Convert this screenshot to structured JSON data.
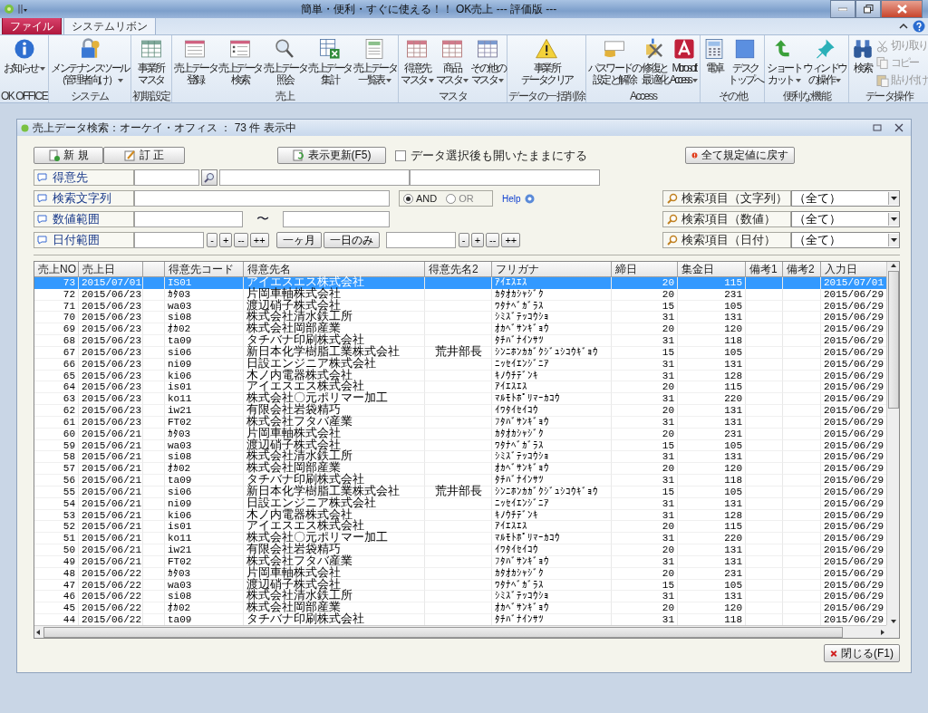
{
  "title_bar": {
    "title": "簡単・便利・すぐに使える！！ OK売上 --- 評価版 ---"
  },
  "ribbon": {
    "tabs": [
      {
        "label": "ファイル",
        "kind": "file",
        "selected": false
      },
      {
        "label": "システムリボン",
        "kind": "tab",
        "selected": true
      }
    ],
    "groups": [
      {
        "label": "OK OFFICE",
        "buttons": [
          {
            "lines": [
              "お知らせ"
            ],
            "dropdown": true
          }
        ]
      },
      {
        "label": "システム",
        "buttons": [
          {
            "lines": [
              "メンテナンスツール",
              "（管理者向け）"
            ],
            "dropdown": true
          }
        ]
      },
      {
        "label": "初期設定",
        "buttons": [
          {
            "lines": [
              "事業所",
              "マスタ"
            ],
            "dropdown": false
          }
        ]
      },
      {
        "label": "売上",
        "buttons": [
          {
            "lines": [
              "売上データ",
              "登録"
            ],
            "dropdown": false
          },
          {
            "lines": [
              "売上データ",
              "検索"
            ],
            "dropdown": false
          },
          {
            "lines": [
              "売上データ",
              "照会"
            ],
            "dropdown": false
          },
          {
            "lines": [
              "売上データ",
              "集計"
            ],
            "dropdown": false
          },
          {
            "lines": [
              "売上データ",
              "一覧表"
            ],
            "dropdown": true
          }
        ]
      },
      {
        "label": "マスタ",
        "buttons": [
          {
            "lines": [
              "得意先",
              "マスタ"
            ],
            "dropdown": true
          },
          {
            "lines": [
              "商品",
              "マスタ"
            ],
            "dropdown": true
          },
          {
            "lines": [
              "その他の",
              "マスタ"
            ],
            "dropdown": true
          }
        ]
      },
      {
        "label": "データの一括削除",
        "buttons": [
          {
            "lines": [
              "事業所",
              "データクリア"
            ],
            "dropdown": false
          }
        ]
      },
      {
        "label": "Access",
        "buttons": [
          {
            "lines": [
              "パスワードの",
              "設定と解除"
            ],
            "dropdown": false
          },
          {
            "lines": [
              "修復と",
              "最適化"
            ],
            "dropdown": false
          },
          {
            "lines": [
              "Microsoft",
              "Access"
            ],
            "dropdown": true
          }
        ]
      },
      {
        "label": "その他",
        "buttons": [
          {
            "lines": [
              "電卓"
            ],
            "dropdown": false
          },
          {
            "lines": [
              "デスク",
              "トップへ"
            ],
            "dropdown": false
          }
        ]
      },
      {
        "label": "便利な機能",
        "buttons": [
          {
            "lines": [
              "ショート",
              "カット"
            ],
            "dropdown": true
          },
          {
            "lines": [
              "ウィンドウ",
              "の操作"
            ],
            "dropdown": true
          }
        ]
      },
      {
        "label": "データ操作",
        "buttons": [
          {
            "lines": [
              "検索"
            ],
            "dropdown": false
          }
        ],
        "small_buttons": [
          {
            "label": "切り取り",
            "disabled": true
          },
          {
            "label": "コピー",
            "disabled": true
          },
          {
            "label": "貼り付け",
            "disabled": true
          }
        ]
      }
    ]
  },
  "search_window": {
    "title": "売上データ検索：オーケイ・オフィス ： 73 件 表示中",
    "toolbar": {
      "new": "新 規",
      "edit": "訂 正",
      "refresh": "表示更新(F5)",
      "keep_open": {
        "label": "データ選択後も開いたままにする",
        "checked": false
      },
      "reset": "全て規定値に戻す"
    },
    "filters": {
      "customer": "得意先",
      "text": "検索文字列",
      "number": "数値範囲",
      "date": "日付範囲",
      "modes": [
        {
          "label": "AND",
          "selected": true
        },
        {
          "label": "OR",
          "selected": false
        }
      ],
      "help": "Help",
      "range_separator": "〜",
      "date_steps": [
        "-",
        "+",
        "--",
        "++"
      ],
      "date_presets": [
        "一ヶ月",
        "一日のみ"
      ],
      "date_steps_2": [
        "-",
        "+",
        "--",
        "++"
      ],
      "search_items": [
        {
          "label": "検索項目（文字列）",
          "value": "（全て）"
        },
        {
          "label": "検索項目（数値）",
          "value": "（全て）"
        },
        {
          "label": "検索項目（日付）",
          "value": "（全て）"
        }
      ]
    },
    "table": {
      "columns": [
        "売上NO",
        "売上日",
        "得意先コード",
        "得意先名",
        "得意先名2",
        "フリガナ",
        "締日",
        "集金日",
        "備考1",
        "備考2",
        "入力日"
      ],
      "rows": [
        {
          "no": "73",
          "date": "2015/07/01",
          "code": "IS01",
          "name": "アイエスエス株式会社",
          "kana": "ｱｲｴｽｴｽ",
          "closing": "20",
          "collection": "115",
          "entry": "2015/07/01",
          "selected": true
        },
        {
          "no": "72",
          "date": "2015/06/23",
          "code": "ｶﾀ03",
          "name": "片岡車軸株式会社",
          "kana": "ｶﾀｵｶｼｬｼﾞｸ",
          "closing": "20",
          "collection": "231",
          "entry": "2015/06/29",
          "selected": false
        },
        {
          "no": "71",
          "date": "2015/06/23",
          "code": "wa03",
          "name": "渡辺硝子株式会社",
          "kana": "ﾜﾀﾅﾍﾞｶﾞﾗｽ",
          "closing": "15",
          "collection": "105",
          "entry": "2015/06/29",
          "selected": false
        },
        {
          "no": "70",
          "date": "2015/06/23",
          "code": "si08",
          "name": "株式会社清水鉄工所",
          "kana": "ｼﾐｽﾞﾃｯｺｳｼｮ",
          "closing": "31",
          "collection": "131",
          "entry": "2015/06/29",
          "selected": false
        },
        {
          "no": "69",
          "date": "2015/06/23",
          "code": "ｵｶ02",
          "name": "株式会社岡部産業",
          "kana": "ｵｶﾍﾞｻﾝｷﾞｮｳ",
          "closing": "20",
          "collection": "120",
          "entry": "2015/06/29",
          "selected": false
        },
        {
          "no": "68",
          "date": "2015/06/23",
          "code": "ta09",
          "name": "タチバナ印刷株式会社",
          "kana": "ﾀﾁﾊﾞﾅｲﾝｻﾂ",
          "closing": "31",
          "collection": "118",
          "entry": "2015/06/29",
          "selected": false
        },
        {
          "no": "67",
          "date": "2015/06/23",
          "code": "si06",
          "name": "新日本化学樹脂工業株式会社",
          "name2": "荒井部長",
          "kana": "ｼﾝﾆﾎﾝｶｶﾞｸｼﾞｭｼｺｳｷﾞｮｳ",
          "closing": "15",
          "collection": "105",
          "entry": "2015/06/29",
          "selected": false
        },
        {
          "no": "66",
          "date": "2015/06/23",
          "code": "ni09",
          "name": "日設エンジニア株式会社",
          "kana": "ﾆｯｾｲｴﾝｼﾞﾆｱ",
          "closing": "31",
          "collection": "131",
          "entry": "2015/06/29",
          "selected": false
        },
        {
          "no": "65",
          "date": "2015/06/23",
          "code": "ki06",
          "name": "木ノ内電器株式会社",
          "kana": "ｷﾉｳﾁﾃﾞﾝｷ",
          "closing": "31",
          "collection": "128",
          "entry": "2015/06/29",
          "selected": false
        },
        {
          "no": "64",
          "date": "2015/06/23",
          "code": "is01",
          "name": "アイエスエス株式会社",
          "kana": "ｱｲｴｽｴｽ",
          "closing": "20",
          "collection": "115",
          "entry": "2015/06/29",
          "selected": false
        },
        {
          "no": "63",
          "date": "2015/06/23",
          "code": "ko11",
          "name": "株式会社〇元ポリマー加工",
          "kana": "ﾏﾙﾓﾄﾎﾟﾘﾏｰｶｺｳ",
          "closing": "31",
          "collection": "220",
          "entry": "2015/06/29",
          "selected": false
        },
        {
          "no": "62",
          "date": "2015/06/23",
          "code": "iw21",
          "name": "有限会社岩袋精巧",
          "kana": "ｲﾜﾀｲｾｲｺｳ",
          "closing": "20",
          "collection": "131",
          "entry": "2015/06/29",
          "selected": false
        },
        {
          "no": "61",
          "date": "2015/06/23",
          "code": "FT02",
          "name": "株式会社フタバ産業",
          "kana": "ﾌﾀﾊﾞｻﾝｷﾞｮｳ",
          "closing": "31",
          "collection": "131",
          "entry": "2015/06/29",
          "selected": false
        },
        {
          "no": "60",
          "date": "2015/06/21",
          "code": "ｶﾀ03",
          "name": "片岡車軸株式会社",
          "kana": "ｶﾀｵｶｼｬｼﾞｸ",
          "closing": "20",
          "collection": "231",
          "entry": "2015/06/29",
          "selected": false
        },
        {
          "no": "59",
          "date": "2015/06/21",
          "code": "wa03",
          "name": "渡辺硝子株式会社",
          "kana": "ﾜﾀﾅﾍﾞｶﾞﾗｽ",
          "closing": "15",
          "collection": "105",
          "entry": "2015/06/29",
          "selected": false
        },
        {
          "no": "58",
          "date": "2015/06/21",
          "code": "si08",
          "name": "株式会社清水鉄工所",
          "kana": "ｼﾐｽﾞﾃｯｺｳｼｮ",
          "closing": "31",
          "collection": "131",
          "entry": "2015/06/29",
          "selected": false
        },
        {
          "no": "57",
          "date": "2015/06/21",
          "code": "ｵｶ02",
          "name": "株式会社岡部産業",
          "kana": "ｵｶﾍﾞｻﾝｷﾞｮｳ",
          "closing": "20",
          "collection": "120",
          "entry": "2015/06/29",
          "selected": false
        },
        {
          "no": "56",
          "date": "2015/06/21",
          "code": "ta09",
          "name": "タチバナ印刷株式会社",
          "kana": "ﾀﾁﾊﾞﾅｲﾝｻﾂ",
          "closing": "31",
          "collection": "118",
          "entry": "2015/06/29",
          "selected": false
        },
        {
          "no": "55",
          "date": "2015/06/21",
          "code": "si06",
          "name": "新日本化学樹脂工業株式会社",
          "name2": "荒井部長",
          "kana": "ｼﾝﾆﾎﾝｶｶﾞｸｼﾞｭｼｺｳｷﾞｮｳ",
          "closing": "15",
          "collection": "105",
          "entry": "2015/06/29",
          "selected": false
        },
        {
          "no": "54",
          "date": "2015/06/21",
          "code": "ni09",
          "name": "日設エンジニア株式会社",
          "kana": "ﾆｯｾｲｴﾝｼﾞﾆｱ",
          "closing": "31",
          "collection": "131",
          "entry": "2015/06/29",
          "selected": false
        },
        {
          "no": "53",
          "date": "2015/06/21",
          "code": "ki06",
          "name": "木ノ内電器株式会社",
          "kana": "ｷﾉｳﾁﾃﾞﾝｷ",
          "closing": "31",
          "collection": "128",
          "entry": "2015/06/29",
          "selected": false
        },
        {
          "no": "52",
          "date": "2015/06/21",
          "code": "is01",
          "name": "アイエスエス株式会社",
          "kana": "ｱｲｴｽｴｽ",
          "closing": "20",
          "collection": "115",
          "entry": "2015/06/29",
          "selected": false
        },
        {
          "no": "51",
          "date": "2015/06/21",
          "code": "ko11",
          "name": "株式会社〇元ポリマー加工",
          "kana": "ﾏﾙﾓﾄﾎﾟﾘﾏｰｶｺｳ",
          "closing": "31",
          "collection": "220",
          "entry": "2015/06/29",
          "selected": false
        },
        {
          "no": "50",
          "date": "2015/06/21",
          "code": "iw21",
          "name": "有限会社岩袋精巧",
          "kana": "ｲﾜﾀｲｾｲｺｳ",
          "closing": "20",
          "collection": "131",
          "entry": "2015/06/29",
          "selected": false
        },
        {
          "no": "49",
          "date": "2015/06/21",
          "code": "FT02",
          "name": "株式会社フタバ産業",
          "kana": "ﾌﾀﾊﾞｻﾝｷﾞｮｳ",
          "closing": "31",
          "collection": "131",
          "entry": "2015/06/29",
          "selected": false
        },
        {
          "no": "48",
          "date": "2015/06/22",
          "code": "ｶﾀ03",
          "name": "片岡車軸株式会社",
          "kana": "ｶﾀｵｶｼｬｼﾞｸ",
          "closing": "20",
          "collection": "231",
          "entry": "2015/06/29",
          "selected": false
        },
        {
          "no": "47",
          "date": "2015/06/22",
          "code": "wa03",
          "name": "渡辺硝子株式会社",
          "kana": "ﾜﾀﾅﾍﾞｶﾞﾗｽ",
          "closing": "15",
          "collection": "105",
          "entry": "2015/06/29",
          "selected": false
        },
        {
          "no": "46",
          "date": "2015/06/22",
          "code": "si08",
          "name": "株式会社清水鉄工所",
          "kana": "ｼﾐｽﾞﾃｯｺｳｼｮ",
          "closing": "31",
          "collection": "131",
          "entry": "2015/06/29",
          "selected": false
        },
        {
          "no": "45",
          "date": "2015/06/22",
          "code": "ｵｶ02",
          "name": "株式会社岡部産業",
          "kana": "ｵｶﾍﾞｻﾝｷﾞｮｳ",
          "closing": "20",
          "collection": "120",
          "entry": "2015/06/29",
          "selected": false
        },
        {
          "no": "44",
          "date": "2015/06/22",
          "code": "ta09",
          "name": "タチバナ印刷株式会社",
          "kana": "ﾀﾁﾊﾞﾅｲﾝｻﾂ",
          "closing": "31",
          "collection": "118",
          "entry": "2015/06/29",
          "selected": false
        }
      ]
    },
    "close_button": "閉じる(F1)"
  }
}
